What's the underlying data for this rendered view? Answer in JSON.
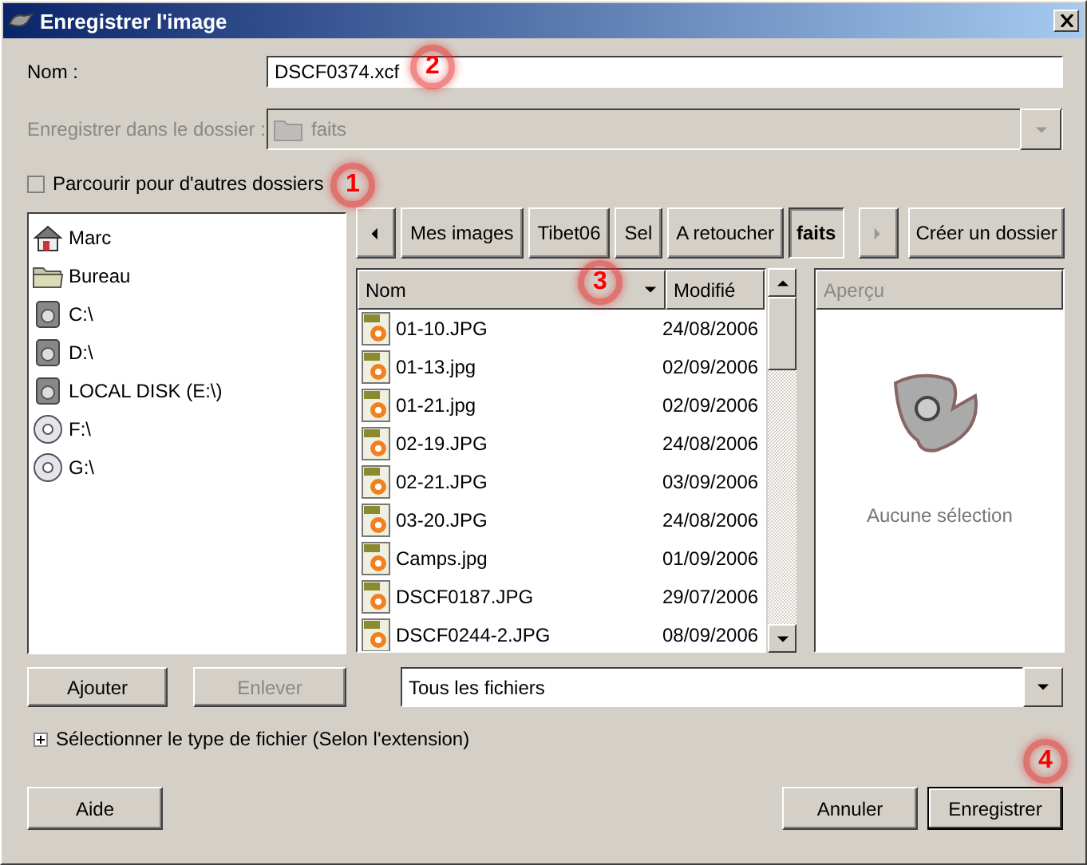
{
  "window": {
    "title": "Enregistrer l'image"
  },
  "name_field": {
    "label": "Nom :",
    "value": "DSCF0374.xcf"
  },
  "folder_field": {
    "label": "Enregistrer dans le dossier :",
    "value": "faits",
    "disabled": true
  },
  "browse_checkbox": {
    "label": "Parcourir pour d'autres dossiers",
    "checked": false
  },
  "places": [
    {
      "label": "Marc",
      "kind": "home"
    },
    {
      "label": "Bureau",
      "kind": "folder"
    },
    {
      "label": "C:\\",
      "kind": "drive"
    },
    {
      "label": "D:\\",
      "kind": "drive"
    },
    {
      "label": "LOCAL DISK (E:\\)",
      "kind": "drive"
    },
    {
      "label": "F:\\",
      "kind": "cdrom"
    },
    {
      "label": "G:\\",
      "kind": "cdrom"
    }
  ],
  "path_bar": {
    "back_disabled": false,
    "forward_disabled": true,
    "buttons": [
      {
        "label": "Mes images",
        "selected": false
      },
      {
        "label": "Tibet06",
        "selected": false
      },
      {
        "label": "Sel",
        "selected": false
      },
      {
        "label": "A retoucher",
        "selected": false
      },
      {
        "label": "faits",
        "selected": true
      }
    ]
  },
  "create_folder_button": {
    "label": "Créer un dossier"
  },
  "file_list": {
    "columns": [
      "Nom",
      "Modifié"
    ],
    "rows": [
      {
        "name": "01-10.JPG",
        "modified": "24/08/2006"
      },
      {
        "name": "01-13.jpg",
        "modified": "02/09/2006"
      },
      {
        "name": "01-21.jpg",
        "modified": "02/09/2006"
      },
      {
        "name": "02-19.JPG",
        "modified": "24/08/2006"
      },
      {
        "name": "02-21.JPG",
        "modified": "03/09/2006"
      },
      {
        "name": "03-20.JPG",
        "modified": "24/08/2006"
      },
      {
        "name": "Camps.jpg",
        "modified": "01/09/2006"
      },
      {
        "name": "DSCF0187.JPG",
        "modified": "29/07/2006"
      },
      {
        "name": "DSCF0244-2.JPG",
        "modified": "08/09/2006"
      }
    ]
  },
  "preview": {
    "title": "Aperçu",
    "message": "Aucune sélection"
  },
  "add_button": {
    "label": "Ajouter",
    "disabled": false
  },
  "remove_button": {
    "label": "Enlever",
    "disabled": true
  },
  "filter": {
    "value": "Tous les fichiers"
  },
  "file_type_expander": {
    "label": "Sélectionner le type de fichier (Selon l'extension)",
    "expanded": false
  },
  "buttons": [
    {
      "label": "Aide",
      "kind": "help"
    },
    {
      "label": "Annuler",
      "kind": "cancel"
    },
    {
      "label": "Enregistrer",
      "kind": "save"
    }
  ],
  "callouts": [
    "1",
    "2",
    "3",
    "4"
  ]
}
